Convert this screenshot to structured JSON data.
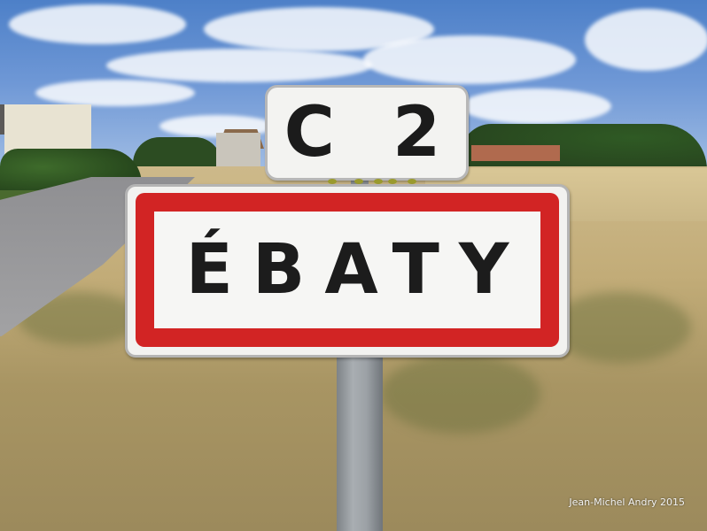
{
  "photo": {
    "sign_route_text": "C 2",
    "sign_town_text": "ÉBATY",
    "credit": "Jean-Michel Andry 2015"
  },
  "colors": {
    "sign_border_red": "#d22424",
    "sign_background": "#f2f2f0",
    "sign_text": "#1c1c1c",
    "sky": "#6f98d6",
    "field": "#c2ac78"
  }
}
